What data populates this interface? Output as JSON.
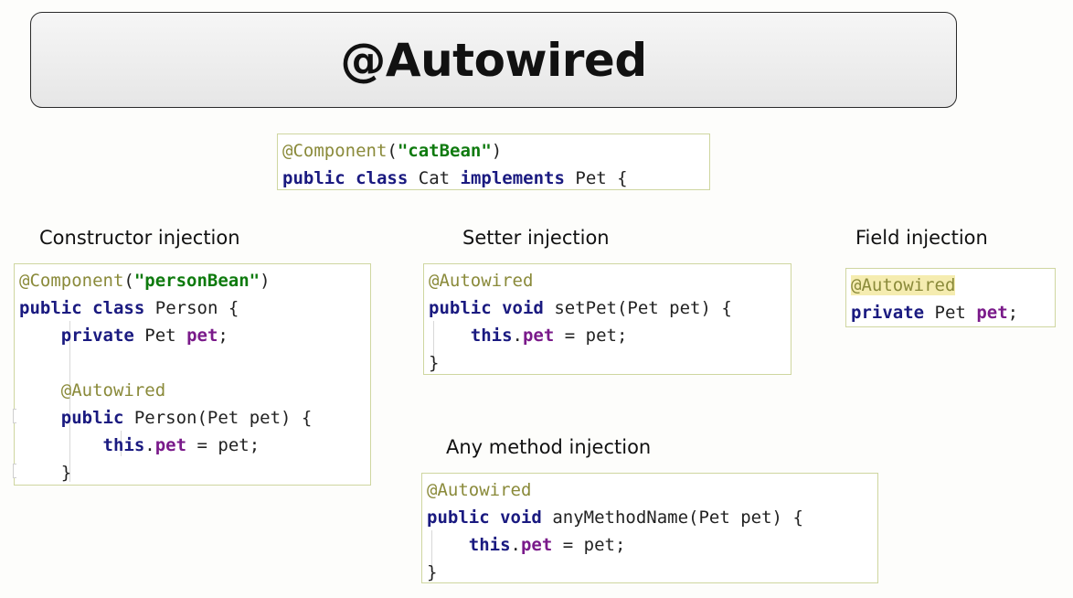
{
  "title": "@Autowired",
  "cat_code": {
    "line1": {
      "annotation": "@Component",
      "paren_open": "(",
      "string": "\"catBean\"",
      "paren_close": ")"
    },
    "line2": {
      "kw1": "public",
      "kw2": "class",
      "name": "Cat",
      "kw3": "implements",
      "iface": "Pet",
      "brace": "{"
    }
  },
  "labels": {
    "constructor": "Constructor injection",
    "setter": "Setter injection",
    "field": "Field injection",
    "any_method": "Any method injection"
  },
  "constructor_code": {
    "l1": {
      "annotation": "@Component",
      "paren_open": "(",
      "string": "\"personBean\"",
      "paren_close": ")"
    },
    "l2": {
      "kw1": "public",
      "kw2": "class",
      "name": "Person",
      "brace": "{"
    },
    "l3": {
      "kw": "private",
      "type": "Pet",
      "field": "pet",
      "semi": ";"
    },
    "l5": {
      "annotation": "@Autowired"
    },
    "l6": {
      "kw": "public",
      "sig": "Person(Pet pet)",
      "brace": "{"
    },
    "l7": {
      "kw": "this",
      "dot": ".",
      "field": "pet",
      "rest": " = pet;"
    },
    "l8": {
      "brace": "}"
    }
  },
  "setter_code": {
    "l1": {
      "annotation": "@Autowired"
    },
    "l2": {
      "kw1": "public",
      "kw2": "void",
      "sig": "setPet(Pet pet)",
      "brace": "{"
    },
    "l3": {
      "kw": "this",
      "dot": ".",
      "field": "pet",
      "rest": " = pet;"
    },
    "l4": {
      "brace": "}"
    }
  },
  "field_code": {
    "l1": {
      "annotation": "@Autowired"
    },
    "l2": {
      "kw": "private",
      "type": "Pet",
      "field": "pet",
      "semi": ";"
    }
  },
  "any_method_code": {
    "l1": {
      "annotation": "@Autowired"
    },
    "l2": {
      "kw1": "public",
      "kw2": "void",
      "sig": "anyMethodName(Pet pet)",
      "brace": "{"
    },
    "l3": {
      "kw": "this",
      "dot": ".",
      "field": "pet",
      "rest": " = pet;"
    },
    "l4": {
      "brace": "}"
    }
  }
}
